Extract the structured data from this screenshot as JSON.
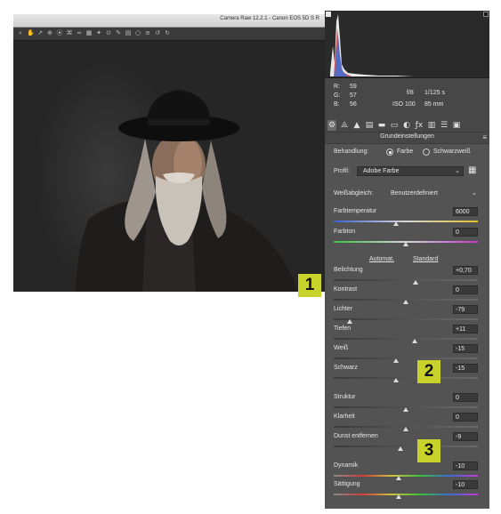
{
  "window": {
    "title": "Camera Raw 12.2.1 - Canon EOS 5D S R"
  },
  "toolbar": {
    "tools": [
      {
        "icon": "zoom-icon",
        "glyph": "⌕"
      },
      {
        "icon": "hand-icon",
        "glyph": "✋"
      },
      {
        "icon": "white-balance-icon",
        "glyph": "↗"
      },
      {
        "icon": "color-sampler-icon",
        "glyph": "⊕"
      },
      {
        "icon": "target-adjust-icon",
        "glyph": "⦿"
      },
      {
        "icon": "crop-icon",
        "glyph": "⌘"
      },
      {
        "icon": "straighten-icon",
        "glyph": "═"
      },
      {
        "icon": "transform-icon",
        "glyph": "▦"
      },
      {
        "icon": "spot-removal-icon",
        "glyph": "✦"
      },
      {
        "icon": "red-eye-icon",
        "glyph": "⊙"
      },
      {
        "icon": "adjustment-brush-icon",
        "glyph": "✎"
      },
      {
        "icon": "graduated-filter-icon",
        "glyph": "▤"
      },
      {
        "icon": "radial-filter-icon",
        "glyph": "○"
      },
      {
        "icon": "preferences-icon",
        "glyph": "≡"
      },
      {
        "icon": "rotate-left-icon",
        "glyph": "↺"
      },
      {
        "icon": "rotate-right-icon",
        "glyph": "↻"
      }
    ]
  },
  "readout": {
    "r_label": "R:",
    "r_value": "59",
    "g_label": "G:",
    "g_value": "57",
    "b_label": "B:",
    "b_value": "56",
    "aperture": "f/8",
    "shutter": "1/125 s",
    "iso": "ISO 100",
    "focal": "85 mm"
  },
  "panel_tabs": [
    {
      "icon": "basic-panel-icon",
      "glyph": "⚙"
    },
    {
      "icon": "tone-curve-icon",
      "glyph": "⨻"
    },
    {
      "icon": "detail-icon",
      "glyph": "▲"
    },
    {
      "icon": "hsl-icon",
      "glyph": "▤"
    },
    {
      "icon": "split-toning-icon",
      "glyph": "▬"
    },
    {
      "icon": "lens-corrections-icon",
      "glyph": "▭"
    },
    {
      "icon": "effects-icon",
      "glyph": "◐"
    },
    {
      "icon": "fx-icon",
      "glyph": "ƒx"
    },
    {
      "icon": "calibration-icon",
      "glyph": "▥"
    },
    {
      "icon": "presets-icon",
      "glyph": "☰"
    },
    {
      "icon": "snapshots-icon",
      "glyph": "▣"
    }
  ],
  "panel": {
    "section_title": "Grundeinstellungen",
    "menu_glyph": "≡",
    "treatment_label": "Behandlung:",
    "treatment_color": "Farbe",
    "treatment_bw": "Schwarzweiß",
    "treatment_selected": "Farbe",
    "profile_label": "Profil:",
    "profile_value": "Adobe Farbe",
    "profile_dropdown_glyph": "⌄",
    "profile_browser_glyph": "▦",
    "wb_label": "Weißabgleich:",
    "wb_value": "Benutzerdefiniert",
    "wb_dropdown_glyph": "⌄",
    "auto_link": "Automat.",
    "standard_link": "Standard"
  },
  "sliders": [
    {
      "id": "farbtemperatur",
      "label": "Farbtemperatur",
      "value": "6000",
      "pos": 0.43,
      "track": "temp"
    },
    {
      "id": "farbton",
      "label": "Farbton",
      "value": "0",
      "pos": 0.5,
      "track": "tint"
    },
    {
      "id": "belichtung",
      "label": "Belichtung",
      "value": "+0,70",
      "pos": 0.57,
      "track": "gray"
    },
    {
      "id": "kontrast",
      "label": "Kontrast",
      "value": "0",
      "pos": 0.5,
      "track": "gray"
    },
    {
      "id": "lichter",
      "label": "Lichter",
      "value": "-79",
      "pos": 0.11,
      "track": "gray"
    },
    {
      "id": "tiefen",
      "label": "Tiefen",
      "value": "+11",
      "pos": 0.56,
      "track": "gray"
    },
    {
      "id": "weiss",
      "label": "Weiß",
      "value": "-15",
      "pos": 0.43,
      "track": "gray"
    },
    {
      "id": "schwarz",
      "label": "Schwarz",
      "value": "-15",
      "pos": 0.43,
      "track": "gray"
    },
    {
      "id": "struktur",
      "label": "Struktur",
      "value": "0",
      "pos": 0.5,
      "track": "gray"
    },
    {
      "id": "klarheit",
      "label": "Klarheit",
      "value": "0",
      "pos": 0.5,
      "track": "gray"
    },
    {
      "id": "dunst",
      "label": "Dunst entfernen",
      "value": "-9",
      "pos": 0.46,
      "track": "gray"
    },
    {
      "id": "dynamik",
      "label": "Dynamik",
      "value": "-10",
      "pos": 0.45,
      "track": "sat"
    },
    {
      "id": "saettigung",
      "label": "Sättigung",
      "value": "-10",
      "pos": 0.45,
      "track": "sat"
    }
  ],
  "badges": [
    "1",
    "2",
    "3"
  ],
  "colors": {
    "badge": "#c8d22b",
    "panel_bg": "#535353"
  }
}
